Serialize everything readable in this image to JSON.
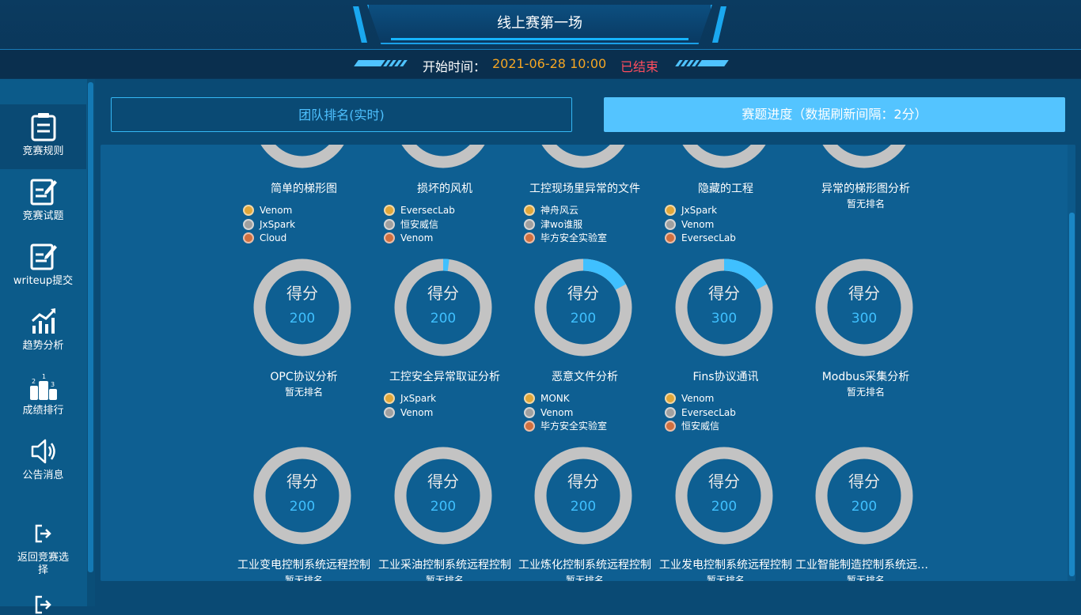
{
  "header": {
    "title": "线上赛第一场",
    "start_label": "开始时间：",
    "start_time": "2021-06-28 10:00",
    "status": "已结束"
  },
  "sidebar": {
    "items": [
      {
        "label": "竞赛规则",
        "icon": "clipboard-icon"
      },
      {
        "label": "竞赛试题",
        "icon": "edit-document-icon"
      },
      {
        "label": "writeup提交",
        "icon": "edit-document-icon"
      },
      {
        "label": "趋势分析",
        "icon": "chart-trend-icon"
      },
      {
        "label": "成绩排行",
        "icon": "podium-icon"
      },
      {
        "label": "公告消息",
        "icon": "speaker-icon"
      },
      {
        "label": "返回竞赛选择",
        "icon": "exit-icon"
      }
    ]
  },
  "tabs": [
    {
      "label": "团队排名(实时)"
    },
    {
      "label": "赛题进度（数据刷新间隔：2分）"
    }
  ],
  "score_label": "得分",
  "no_rank": "暂无排名",
  "challenges": [
    {
      "name": "简单的梯形图",
      "progress": 0.0,
      "ranks": [
        "Venom",
        "JxSpark",
        "Cloud"
      ]
    },
    {
      "name": "损坏的风机",
      "progress": 0.12,
      "ranks": [
        "EversecLab",
        "恒安威信",
        "Venom"
      ]
    },
    {
      "name": "工控现场里异常的文件",
      "progress": 0.0,
      "ranks": [
        "神舟风云",
        "津wo谁服",
        "毕方安全实验室"
      ]
    },
    {
      "name": "隐藏的工程",
      "progress": 0.0,
      "ranks": [
        "JxSpark",
        "Venom",
        "EversecLab"
      ]
    },
    {
      "name": "异常的梯形图分析",
      "progress": 0.0,
      "ranks": []
    },
    {
      "name": "OPC协议分析",
      "score": "200",
      "progress": 0.0,
      "ranks": []
    },
    {
      "name": "工控安全异常取证分析",
      "score": "200",
      "progress": 0.02,
      "ranks": [
        "JxSpark",
        "Venom"
      ]
    },
    {
      "name": "恶意文件分析",
      "score": "200",
      "progress": 0.17,
      "ranks": [
        "MONK",
        "Venom",
        "毕方安全实验室"
      ]
    },
    {
      "name": "Fins协议通讯",
      "score": "300",
      "progress": 0.17,
      "ranks": [
        "Venom",
        "EversecLab",
        "恒安威信"
      ]
    },
    {
      "name": "Modbus采集分析",
      "score": "300",
      "progress": 0.0,
      "ranks": []
    },
    {
      "name": "工业变电控制系统远程控制",
      "score": "200",
      "progress": 0.0,
      "ranks": []
    },
    {
      "name": "工业采油控制系统远程控制",
      "score": "200",
      "progress": 0.0,
      "ranks": []
    },
    {
      "name": "工业炼化控制系统远程控制",
      "score": "200",
      "progress": 0.0,
      "ranks": []
    },
    {
      "name": "工业发电控制系统远程控制",
      "score": "200",
      "progress": 0.0,
      "ranks": []
    },
    {
      "name": "工业智能制造控制系统远程控制",
      "score": "200",
      "progress": 0.0,
      "ranks": []
    }
  ],
  "colors": {
    "accent": "#3fc0ff",
    "ring": "#c3c3c3",
    "status": "#ff4d5e",
    "time": "#f5a623"
  }
}
